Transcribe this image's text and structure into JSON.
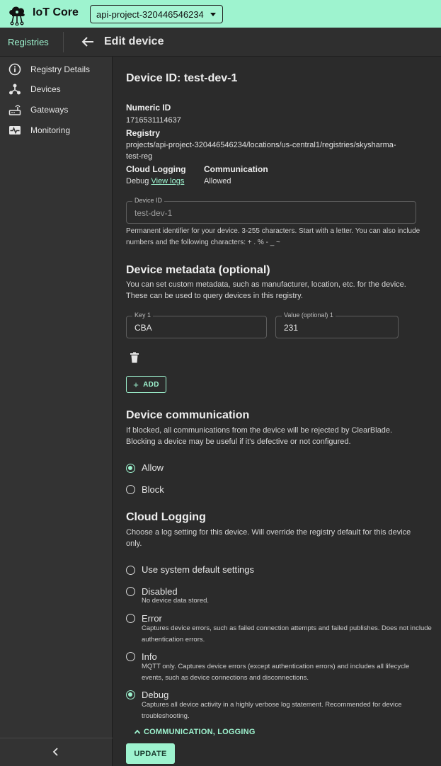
{
  "app": {
    "title": "IoT Core",
    "project": "api-project-320446546234"
  },
  "header": {
    "breadcrumb": "Registries",
    "title": "Edit device"
  },
  "sidebar": {
    "items": [
      {
        "label": "Registry Details",
        "icon": "info-icon"
      },
      {
        "label": "Devices",
        "icon": "devices-icon"
      },
      {
        "label": "Gateways",
        "icon": "gateway-icon"
      },
      {
        "label": "Monitoring",
        "icon": "monitoring-icon"
      }
    ]
  },
  "device": {
    "heading": "Device ID: test-dev-1",
    "numeric_id_label": "Numeric ID",
    "numeric_id": "1716531114637",
    "registry_label": "Registry",
    "registry_line1": "projects/api-project-320446546234/locations/us-central1/registries/skysharma-",
    "registry_line2": "test-reg",
    "logging_label": "Cloud Logging",
    "logging_value": "Debug",
    "logging_link": "View logs",
    "communication_label": "Communication",
    "communication_value": "Allowed"
  },
  "device_id_field": {
    "label": "Device ID",
    "value": "test-dev-1",
    "help": "Permanent identifier for your device. 3-255 characters. Start with a letter. You can also include numbers and the following characters: + . % - _ ~"
  },
  "metadata": {
    "title": "Device metadata (optional)",
    "description": "You can set custom metadata, such as manufacturer, location, etc. for the device. These can be used to query devices in this registry.",
    "key_label": "Key 1",
    "key_value": "CBA",
    "value_label": "Value (optional) 1",
    "value_value": "231",
    "add_label": "ADD"
  },
  "communication": {
    "title": "Device communication",
    "description": "If blocked, all communications from the device will be rejected by ClearBlade. Blocking a device may be useful if it's defective or not configured.",
    "options": [
      {
        "label": "Allow",
        "selected": true
      },
      {
        "label": "Block",
        "selected": false
      }
    ]
  },
  "logging": {
    "title": "Cloud Logging",
    "description": "Choose a log setting for this device. Will override the registry default for this device only.",
    "options": [
      {
        "label": "Use system default settings",
        "detail": "",
        "selected": false
      },
      {
        "label": "Disabled",
        "detail": "No device data stored.",
        "selected": false
      },
      {
        "label": "Error",
        "detail": "Captures device errors, such as failed connection attempts and failed publishes. Does not include authentication errors.",
        "selected": false
      },
      {
        "label": "Info",
        "detail": "MQTT only. Captures device errors (except authentication errors) and includes all lifecycle events, such as device connections and disconnections.",
        "selected": false
      },
      {
        "label": "Debug",
        "detail": "Captures all device activity in a highly verbose log statement. Recommended for device troubleshooting.",
        "selected": true
      }
    ]
  },
  "actions": {
    "collapse_label": "COMMUNICATION, LOGGING",
    "update_label": "UPDATE"
  },
  "colors": {
    "accent": "#9ef3cf",
    "background": "#2b2b2b",
    "sidebar": "#333333"
  }
}
